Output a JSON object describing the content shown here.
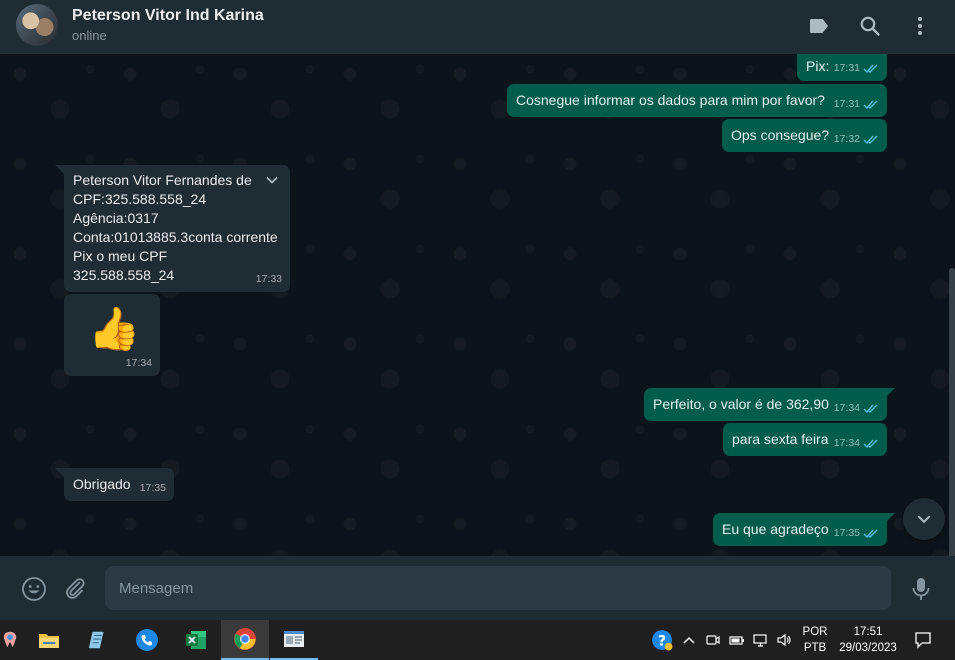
{
  "header": {
    "contact_name": "Peterson Vitor Ind Karina",
    "status": "online",
    "icons": [
      "label-icon",
      "search-icon",
      "menu-icon"
    ]
  },
  "messages": {
    "m1": {
      "direction": "out",
      "text": "Pix:",
      "time": "17:31",
      "ticks": "double-check"
    },
    "m2": {
      "direction": "out",
      "text": "Cosnegue informar os dados para mim por favor?",
      "time": "17:31",
      "ticks": "double-check"
    },
    "m3": {
      "direction": "out",
      "text": "Ops consegue?",
      "time": "17:32",
      "ticks": "double-check"
    },
    "m4": {
      "direction": "in",
      "lines": [
        "Peterson Vitor Fernandes de",
        "CPF:325.588.558_24",
        "Agência:0317",
        "Conta:01013885.3conta corrente",
        "Pix o meu CPF",
        "325.588.558_24"
      ],
      "time": "17:33"
    },
    "m5": {
      "direction": "in",
      "emoji": "👍",
      "time": "17:34"
    },
    "m6": {
      "direction": "out",
      "text": "Perfeito, o valor é de 362,90",
      "time": "17:34",
      "ticks": "double-check"
    },
    "m7": {
      "direction": "out",
      "text": "para sexta feira",
      "time": "17:34",
      "ticks": "double-check"
    },
    "m8": {
      "direction": "in",
      "text": "Obrigado",
      "time": "17:35"
    },
    "m9": {
      "direction": "out",
      "text": "Eu que agradeço",
      "time": "17:35",
      "ticks": "double-check"
    }
  },
  "composer": {
    "placeholder": "Mensagem",
    "icons": [
      "emoji-icon",
      "attach-icon",
      "mic-icon"
    ]
  },
  "taskbar": {
    "apps": [
      "app-icon",
      "file-explorer-icon",
      "notepad-icon",
      "phone-app-icon",
      "excel-icon",
      "chrome-icon",
      "whatsapp-window-icon"
    ],
    "language": {
      "line1": "POR",
      "line2": "PTB"
    },
    "clock": {
      "time": "17:51",
      "date": "29/03/2023"
    }
  },
  "colors": {
    "header_bg": "#202c33",
    "chat_bg": "#0b141a",
    "outgoing_bubble": "#005c4b",
    "incoming_bubble": "#202c33",
    "tick_blue": "#53bdeb",
    "taskbar_bg": "#1f1f1f"
  }
}
